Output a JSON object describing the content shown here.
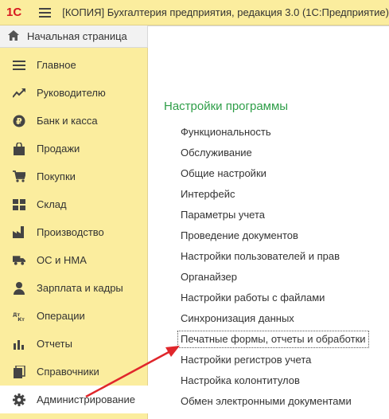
{
  "titlebar": {
    "logo": "1С",
    "title": "[КОПИЯ] Бухгалтерия предприятия, редакция 3.0  (1С:Предприятие)"
  },
  "home": {
    "label": "Начальная страница",
    "icon": "home-icon"
  },
  "sidebar": {
    "items": [
      {
        "label": "Главное",
        "icon": "list-icon"
      },
      {
        "label": "Руководителю",
        "icon": "trend-icon"
      },
      {
        "label": "Банк и касса",
        "icon": "ruble-coin-icon"
      },
      {
        "label": "Продажи",
        "icon": "shopping-bag-icon"
      },
      {
        "label": "Покупки",
        "icon": "cart-icon"
      },
      {
        "label": "Склад",
        "icon": "warehouse-icon"
      },
      {
        "label": "Производство",
        "icon": "factory-icon"
      },
      {
        "label": "ОС и НМА",
        "icon": "truck-icon"
      },
      {
        "label": "Зарплата и кадры",
        "icon": "person-icon"
      },
      {
        "label": "Операции",
        "icon": "dt-kt-icon",
        "icon_text": "Дт Кт"
      },
      {
        "label": "Отчеты",
        "icon": "bar-chart-icon"
      },
      {
        "label": "Справочники",
        "icon": "books-icon"
      },
      {
        "label": "Администрирование",
        "icon": "gear-icon",
        "active": true
      }
    ]
  },
  "content": {
    "section_title": "Настройки программы",
    "links": [
      "Функциональность",
      "Обслуживание",
      "Общие настройки",
      "Интерфейс",
      "Параметры учета",
      "Проведение документов",
      "Настройки пользователей и прав",
      "Органайзер",
      "Настройки работы с файлами",
      "Синхронизация данных",
      "Печатные формы, отчеты и обработки",
      "Настройки регистров учета",
      "Настройка колонтитулов",
      "Обмен электронными документами"
    ],
    "focused_link": "Печатные формы, отчеты и обработки"
  },
  "colors": {
    "sidebar_bg": "#fbed9e",
    "section_title": "#2e9e48",
    "logo": "#d71920",
    "annotation_arrow": "#e0262b"
  }
}
